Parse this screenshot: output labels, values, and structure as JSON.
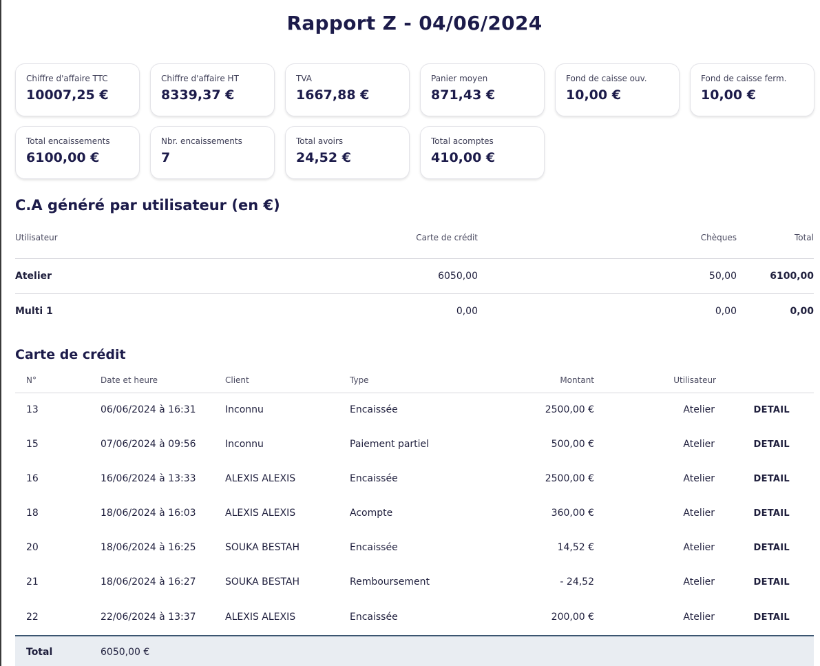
{
  "page_title": "Rapport Z - 04/06/2024",
  "summary_cards": [
    {
      "label": "Chiffre d'affaire TTC",
      "value": "10007,25 €"
    },
    {
      "label": "Chiffre d'affaire HT",
      "value": "8339,37 €"
    },
    {
      "label": "TVA",
      "value": "1667,88 €"
    },
    {
      "label": "Panier moyen",
      "value": "871,43 €"
    },
    {
      "label": "Fond de caisse ouv.",
      "value": "10,00 €"
    },
    {
      "label": "Fond de caisse ferm.",
      "value": "10,00 €"
    },
    {
      "label": "Total encaissements",
      "value": "6100,00 €"
    },
    {
      "label": "Nbr. encaissements",
      "value": "7"
    },
    {
      "label": "Total avoirs",
      "value": "24,52 €"
    },
    {
      "label": "Total acomptes",
      "value": "410,00 €"
    }
  ],
  "users_section": {
    "title": "C.A généré par utilisateur (en €)",
    "headers": [
      "Utilisateur",
      "Carte de crédit",
      "Chèques",
      "Total"
    ],
    "rows": [
      {
        "user": "Atelier",
        "credit_card": "6050,00",
        "cheques": "50,00",
        "total": "6100,00"
      },
      {
        "user": "Multi 1",
        "credit_card": "0,00",
        "cheques": "0,00",
        "total": "0,00"
      }
    ]
  },
  "credit_card_section": {
    "title": "Carte de crédit",
    "headers": [
      "N°",
      "Date et heure",
      "Client",
      "Type",
      "Montant",
      "Utilisateur"
    ],
    "detail_label": "DETAIL",
    "rows": [
      {
        "num": "13",
        "datetime": "06/06/2024 à 16:31",
        "client": "Inconnu",
        "type": "Encaissée",
        "amount": "2500,00 €",
        "user": "Atelier"
      },
      {
        "num": "15",
        "datetime": "07/06/2024 à 09:56",
        "client": "Inconnu",
        "type": "Paiement partiel",
        "amount": "500,00 €",
        "user": "Atelier"
      },
      {
        "num": "16",
        "datetime": "16/06/2024 à 13:33",
        "client": "ALEXIS ALEXIS",
        "type": "Encaissée",
        "amount": "2500,00 €",
        "user": "Atelier"
      },
      {
        "num": "18",
        "datetime": "18/06/2024 à 16:03",
        "client": "ALEXIS ALEXIS",
        "type": "Acompte",
        "amount": "360,00 €",
        "user": "Atelier"
      },
      {
        "num": "20",
        "datetime": "18/06/2024 à 16:25",
        "client": "SOUKA BESTAH",
        "type": "Encaissée",
        "amount": "14,52 €",
        "user": "Atelier"
      },
      {
        "num": "21",
        "datetime": "18/06/2024 à 16:27",
        "client": "SOUKA BESTAH",
        "type": "Remboursement",
        "amount": "- 24,52",
        "user": "Atelier"
      },
      {
        "num": "22",
        "datetime": "22/06/2024 à 13:37",
        "client": "ALEXIS ALEXIS",
        "type": "Encaissée",
        "amount": "200,00 €",
        "user": "Atelier"
      }
    ],
    "total_label": "Total",
    "total_value": "6050,00 €"
  }
}
